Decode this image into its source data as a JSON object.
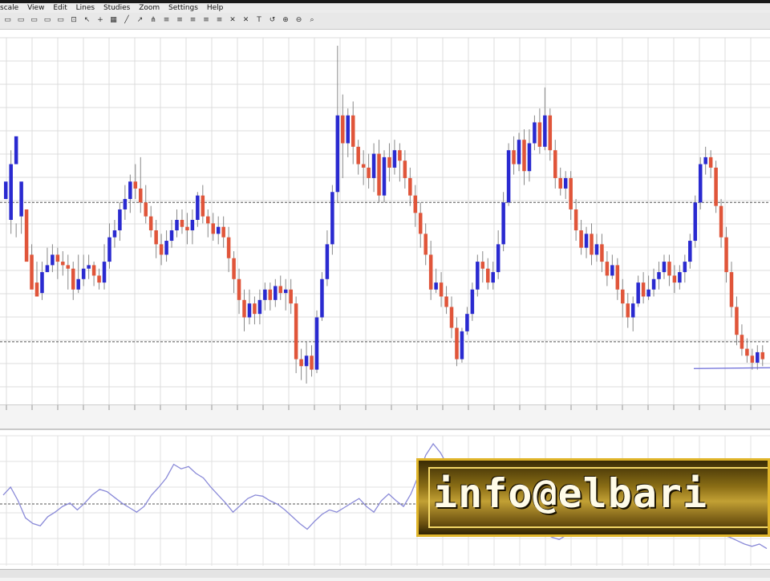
{
  "menu": [
    "scale",
    "View",
    "Edit",
    "Lines",
    "Studies",
    "Zoom",
    "Settings",
    "Help"
  ],
  "toolbar_icons": [
    "period-icon",
    "period-icon",
    "period-icon",
    "period-icon",
    "period-icon",
    "zoom-fit-icon",
    "cursor-icon",
    "crosshair-icon",
    "grid-icon",
    "line-icon",
    "arrow-icon",
    "pitchfork-icon",
    "fib-icon",
    "fib-icon",
    "fib-icon",
    "fib-icon",
    "fib-icon",
    "delete-icon",
    "delete-icon",
    "text-icon",
    "undo-icon",
    "zoom-in-icon",
    "zoom-out-icon",
    "zoom-icon"
  ],
  "chart_data": {
    "type": "candlestick",
    "title": "",
    "series": [
      {
        "name": "price",
        "ohlc": [
          [
            0.56,
            0.61,
            0.5,
            0.5
          ],
          [
            0.5,
            0.66,
            0.7,
            0.46
          ],
          [
            0.66,
            0.74,
            0.49,
            0.45
          ],
          [
            0.51,
            0.61,
            0.53,
            0.46
          ],
          [
            0.53,
            0.38,
            0.53,
            0.4
          ],
          [
            0.4,
            0.3,
            0.43,
            0.31
          ],
          [
            0.32,
            0.28,
            0.38,
            0.28
          ],
          [
            0.29,
            0.35,
            0.38,
            0.27
          ],
          [
            0.35,
            0.37,
            0.42,
            0.35
          ],
          [
            0.37,
            0.4,
            0.43,
            0.35
          ],
          [
            0.4,
            0.38,
            0.42,
            0.33
          ],
          [
            0.38,
            0.37,
            0.41,
            0.34
          ],
          [
            0.37,
            0.36,
            0.4,
            0.3
          ],
          [
            0.36,
            0.3,
            0.38,
            0.27
          ],
          [
            0.3,
            0.33,
            0.4,
            0.29
          ],
          [
            0.33,
            0.36,
            0.4,
            0.31
          ],
          [
            0.36,
            0.37,
            0.4,
            0.33
          ],
          [
            0.37,
            0.34,
            0.38,
            0.31
          ],
          [
            0.34,
            0.32,
            0.36,
            0.3
          ],
          [
            0.32,
            0.38,
            0.43,
            0.3
          ],
          [
            0.38,
            0.45,
            0.49,
            0.36
          ],
          [
            0.45,
            0.47,
            0.5,
            0.42
          ],
          [
            0.47,
            0.53,
            0.55,
            0.44
          ],
          [
            0.53,
            0.56,
            0.6,
            0.5
          ],
          [
            0.56,
            0.61,
            0.63,
            0.52
          ],
          [
            0.61,
            0.59,
            0.66,
            0.56
          ],
          [
            0.59,
            0.55,
            0.68,
            0.52
          ],
          [
            0.55,
            0.51,
            0.6,
            0.49
          ],
          [
            0.51,
            0.47,
            0.54,
            0.45
          ],
          [
            0.47,
            0.43,
            0.5,
            0.39
          ],
          [
            0.43,
            0.4,
            0.46,
            0.37
          ],
          [
            0.4,
            0.44,
            0.47,
            0.38
          ],
          [
            0.44,
            0.47,
            0.5,
            0.42
          ],
          [
            0.47,
            0.5,
            0.53,
            0.45
          ],
          [
            0.5,
            0.48,
            0.53,
            0.46
          ],
          [
            0.48,
            0.47,
            0.52,
            0.43
          ],
          [
            0.47,
            0.5,
            0.53,
            0.43
          ],
          [
            0.5,
            0.57,
            0.58,
            0.48
          ],
          [
            0.57,
            0.51,
            0.6,
            0.49
          ],
          [
            0.51,
            0.49,
            0.53,
            0.45
          ],
          [
            0.49,
            0.46,
            0.52,
            0.44
          ],
          [
            0.46,
            0.48,
            0.51,
            0.43
          ],
          [
            0.48,
            0.45,
            0.51,
            0.42
          ],
          [
            0.45,
            0.39,
            0.48,
            0.35
          ],
          [
            0.39,
            0.33,
            0.41,
            0.29
          ],
          [
            0.33,
            0.27,
            0.36,
            0.23
          ],
          [
            0.27,
            0.22,
            0.3,
            0.18
          ],
          [
            0.22,
            0.26,
            0.3,
            0.2
          ],
          [
            0.26,
            0.23,
            0.28,
            0.2
          ],
          [
            0.23,
            0.27,
            0.3,
            0.2
          ],
          [
            0.27,
            0.3,
            0.32,
            0.24
          ],
          [
            0.3,
            0.27,
            0.32,
            0.24
          ],
          [
            0.27,
            0.31,
            0.33,
            0.25
          ],
          [
            0.31,
            0.29,
            0.34,
            0.27
          ],
          [
            0.29,
            0.3,
            0.33,
            0.24
          ],
          [
            0.3,
            0.26,
            0.33,
            0.23
          ],
          [
            0.26,
            0.1,
            0.28,
            0.06
          ],
          [
            0.1,
            0.08,
            0.13,
            0.04
          ],
          [
            0.08,
            0.11,
            0.15,
            0.03
          ],
          [
            0.11,
            0.07,
            0.14,
            0.05
          ],
          [
            0.07,
            0.22,
            0.24,
            0.06
          ],
          [
            0.22,
            0.33,
            0.35,
            0.21
          ],
          [
            0.33,
            0.43,
            0.47,
            0.31
          ],
          [
            0.43,
            0.58,
            0.6,
            0.4
          ],
          [
            0.58,
            0.8,
            1.0,
            0.55
          ],
          [
            0.8,
            0.72,
            0.86,
            0.62
          ],
          [
            0.72,
            0.8,
            0.82,
            0.68
          ],
          [
            0.8,
            0.71,
            0.84,
            0.66
          ],
          [
            0.71,
            0.66,
            0.73,
            0.63
          ],
          [
            0.66,
            0.65,
            0.7,
            0.6
          ],
          [
            0.65,
            0.62,
            0.69,
            0.59
          ],
          [
            0.62,
            0.69,
            0.72,
            0.58
          ],
          [
            0.69,
            0.57,
            0.73,
            0.55
          ],
          [
            0.57,
            0.68,
            0.7,
            0.55
          ],
          [
            0.68,
            0.65,
            0.72,
            0.61
          ],
          [
            0.65,
            0.7,
            0.73,
            0.63
          ],
          [
            0.7,
            0.67,
            0.72,
            0.61
          ],
          [
            0.67,
            0.62,
            0.7,
            0.59
          ],
          [
            0.62,
            0.57,
            0.65,
            0.54
          ],
          [
            0.57,
            0.52,
            0.6,
            0.48
          ],
          [
            0.52,
            0.46,
            0.55,
            0.42
          ],
          [
            0.46,
            0.4,
            0.49,
            0.37
          ],
          [
            0.4,
            0.3,
            0.44,
            0.27
          ],
          [
            0.3,
            0.32,
            0.36,
            0.29
          ],
          [
            0.32,
            0.28,
            0.35,
            0.25
          ],
          [
            0.28,
            0.25,
            0.31,
            0.23
          ],
          [
            0.25,
            0.19,
            0.28,
            0.16
          ],
          [
            0.19,
            0.1,
            0.22,
            0.08
          ],
          [
            0.1,
            0.18,
            0.19,
            0.09
          ],
          [
            0.18,
            0.23,
            0.25,
            0.17
          ],
          [
            0.23,
            0.3,
            0.32,
            0.21
          ],
          [
            0.3,
            0.38,
            0.4,
            0.28
          ],
          [
            0.38,
            0.36,
            0.41,
            0.32
          ],
          [
            0.36,
            0.32,
            0.39,
            0.3
          ],
          [
            0.32,
            0.35,
            0.38,
            0.3
          ],
          [
            0.35,
            0.43,
            0.47,
            0.33
          ],
          [
            0.43,
            0.55,
            0.58,
            0.41
          ],
          [
            0.55,
            0.7,
            0.72,
            0.54
          ],
          [
            0.7,
            0.66,
            0.74,
            0.63
          ],
          [
            0.66,
            0.73,
            0.75,
            0.64
          ],
          [
            0.73,
            0.64,
            0.76,
            0.6
          ],
          [
            0.64,
            0.72,
            0.76,
            0.61
          ],
          [
            0.72,
            0.78,
            0.8,
            0.7
          ],
          [
            0.78,
            0.71,
            0.82,
            0.69
          ],
          [
            0.71,
            0.8,
            0.88,
            0.7
          ],
          [
            0.8,
            0.7,
            0.82,
            0.67
          ],
          [
            0.7,
            0.62,
            0.73,
            0.59
          ],
          [
            0.62,
            0.59,
            0.65,
            0.57
          ],
          [
            0.59,
            0.62,
            0.64,
            0.56
          ],
          [
            0.62,
            0.53,
            0.64,
            0.5
          ],
          [
            0.53,
            0.47,
            0.56,
            0.44
          ],
          [
            0.47,
            0.42,
            0.5,
            0.4
          ],
          [
            0.42,
            0.46,
            0.48,
            0.39
          ],
          [
            0.46,
            0.4,
            0.49,
            0.37
          ],
          [
            0.4,
            0.43,
            0.46,
            0.38
          ],
          [
            0.43,
            0.38,
            0.46,
            0.35
          ],
          [
            0.38,
            0.34,
            0.41,
            0.31
          ],
          [
            0.34,
            0.37,
            0.4,
            0.33
          ],
          [
            0.37,
            0.3,
            0.39,
            0.27
          ],
          [
            0.3,
            0.26,
            0.33,
            0.22
          ],
          [
            0.26,
            0.22,
            0.29,
            0.19
          ],
          [
            0.22,
            0.26,
            0.28,
            0.18
          ],
          [
            0.26,
            0.32,
            0.34,
            0.25
          ],
          [
            0.32,
            0.28,
            0.35,
            0.26
          ],
          [
            0.28,
            0.3,
            0.34,
            0.27
          ],
          [
            0.3,
            0.33,
            0.36,
            0.28
          ],
          [
            0.33,
            0.35,
            0.38,
            0.3
          ],
          [
            0.35,
            0.38,
            0.4,
            0.33
          ],
          [
            0.38,
            0.34,
            0.4,
            0.31
          ],
          [
            0.34,
            0.32,
            0.37,
            0.29
          ],
          [
            0.32,
            0.35,
            0.37,
            0.3
          ],
          [
            0.35,
            0.38,
            0.4,
            0.32
          ],
          [
            0.38,
            0.44,
            0.46,
            0.36
          ],
          [
            0.44,
            0.55,
            0.57,
            0.42
          ],
          [
            0.55,
            0.66,
            0.68,
            0.53
          ],
          [
            0.66,
            0.68,
            0.71,
            0.63
          ],
          [
            0.68,
            0.65,
            0.7,
            0.62
          ],
          [
            0.65,
            0.54,
            0.67,
            0.52
          ],
          [
            0.54,
            0.45,
            0.56,
            0.42
          ],
          [
            0.45,
            0.35,
            0.48,
            0.32
          ],
          [
            0.35,
            0.25,
            0.38,
            0.22
          ],
          [
            0.25,
            0.17,
            0.28,
            0.14
          ],
          [
            0.17,
            0.13,
            0.2,
            0.11
          ],
          [
            0.13,
            0.11,
            0.16,
            0.09
          ],
          [
            0.11,
            0.09,
            0.13,
            0.07
          ],
          [
            0.09,
            0.12,
            0.14,
            0.07
          ],
          [
            0.12,
            0.1,
            0.14,
            0.08
          ]
        ]
      }
    ],
    "hlines": [
      0.55,
      0.15
    ],
    "oscillator": [
      0.55,
      0.62,
      0.5,
      0.35,
      0.3,
      0.28,
      0.36,
      0.4,
      0.45,
      0.48,
      0.42,
      0.48,
      0.55,
      0.6,
      0.58,
      0.53,
      0.48,
      0.44,
      0.4,
      0.45,
      0.55,
      0.62,
      0.7,
      0.82,
      0.78,
      0.8,
      0.74,
      0.7,
      0.62,
      0.55,
      0.48,
      0.4,
      0.46,
      0.52,
      0.55,
      0.54,
      0.5,
      0.47,
      0.42,
      0.36,
      0.3,
      0.25,
      0.32,
      0.38,
      0.42,
      0.4,
      0.44,
      0.48,
      0.52,
      0.45,
      0.4,
      0.5,
      0.56,
      0.5,
      0.45,
      0.56,
      0.72,
      0.9,
      1.0,
      0.92,
      0.8,
      0.86,
      0.74,
      0.62,
      0.55,
      0.48,
      0.5,
      0.56,
      0.62,
      0.55,
      0.48,
      0.4,
      0.3,
      0.22,
      0.18,
      0.16,
      0.2,
      0.28,
      0.36,
      0.42,
      0.45,
      0.48,
      0.52,
      0.55,
      0.5,
      0.44,
      0.4,
      0.36,
      0.32,
      0.3,
      0.28,
      0.26,
      0.3,
      0.34,
      0.3,
      0.26,
      0.22,
      0.2,
      0.18,
      0.15,
      0.12,
      0.1,
      0.12,
      0.08
    ]
  },
  "promo": {
    "text": "info@elbari"
  }
}
